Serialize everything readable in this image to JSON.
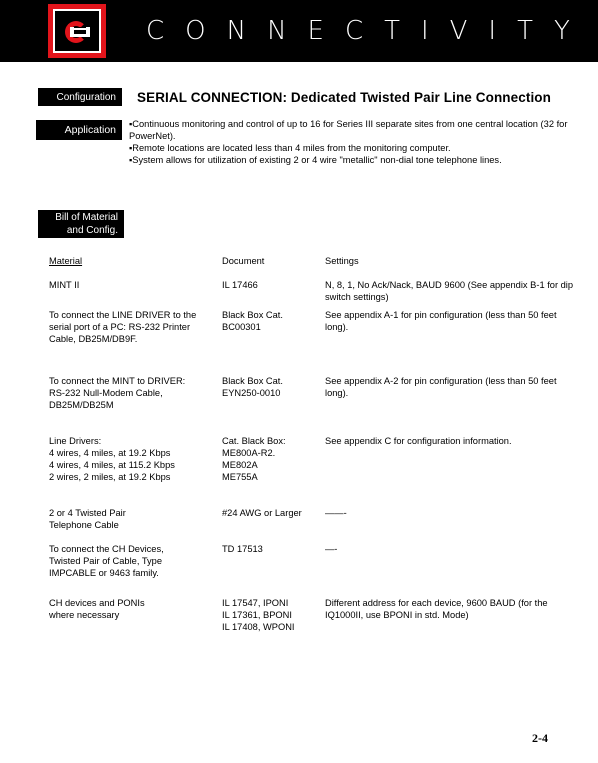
{
  "header": {
    "brand_title": "CONNECTIVITY",
    "logo_icon": "cutler-hammer-logo",
    "colors": {
      "bar": "#000000",
      "logo_red": "#e2141b",
      "text": "#ffffff"
    }
  },
  "labels": {
    "configuration": "Configuration",
    "application": "Application",
    "bill_of_material": "Bill of Material\nand Config."
  },
  "section_title": "SERIAL CONNECTION: Dedicated Twisted Pair  Line Connection",
  "application_bullets": [
    "▪Continuous monitoring and control of up to 16 for Series III separate sites from one central location (32 for PowerNet).",
    "▪Remote locations are located less than 4 miles from the monitoring computer.",
    "▪System allows for utilization of existing 2 or 4 wire \"metallic\" non-dial tone telephone lines."
  ],
  "bom_table": {
    "headers": {
      "material": "Material",
      "document": "Document",
      "settings": "Settings"
    },
    "rows": [
      {
        "material": "MINT II",
        "document": "IL 17466",
        "settings": "N, 8, 1, No Ack/Nack, BAUD 9600 (See appendix B-1 for dip switch settings)"
      },
      {
        "material": "To connect the LINE DRIVER  to the serial port of a PC: RS-232 Printer Cable, DB25M/DB9F.",
        "document": "Black Box Cat.\nBC00301",
        "settings": "See appendix A-1 for pin configuration (less than 50 feet long)."
      },
      {
        "material": "To connect the MINT to DRIVER:\nRS-232 Null-Modem  Cable,\nDB25M/DB25M",
        "document": "Black Box Cat.\nEYN250-0010",
        "settings": "See appendix A-2 for pin configuration (less than 50 feet long)."
      },
      {
        "material": "Line Drivers:\n4 wires, 4  miles, at  19.2  Kbps\n4 wires, 4  miles, at 115.2 Kbps\n2 wires, 2  miles, at  19.2  Kbps",
        "document": "Cat. Black Box:\nME800A-R2.\nME802A\nME755A",
        "settings": "See appendix C for configuration information."
      },
      {
        "material": "2 or 4 Twisted Pair\nTelephone Cable",
        "document": "#24 AWG or Larger",
        "settings": "——-"
      },
      {
        "material": "To connect the CH Devices,\nTwisted Pair of Cable, Type\nIMPCABLE or 9463 family.",
        "document": "TD 17513",
        "settings": "—-"
      },
      {
        "material": "CH devices and PONIs\nwhere necessary",
        "document": "IL 17547, IPONI\nIL 17361, BPONI\nIL 17408, WPONI",
        "settings": "Different address for each device, 9600 BAUD (for the IQ1000II, use BPONI in std. Mode)"
      }
    ]
  },
  "page_number": "2-4"
}
